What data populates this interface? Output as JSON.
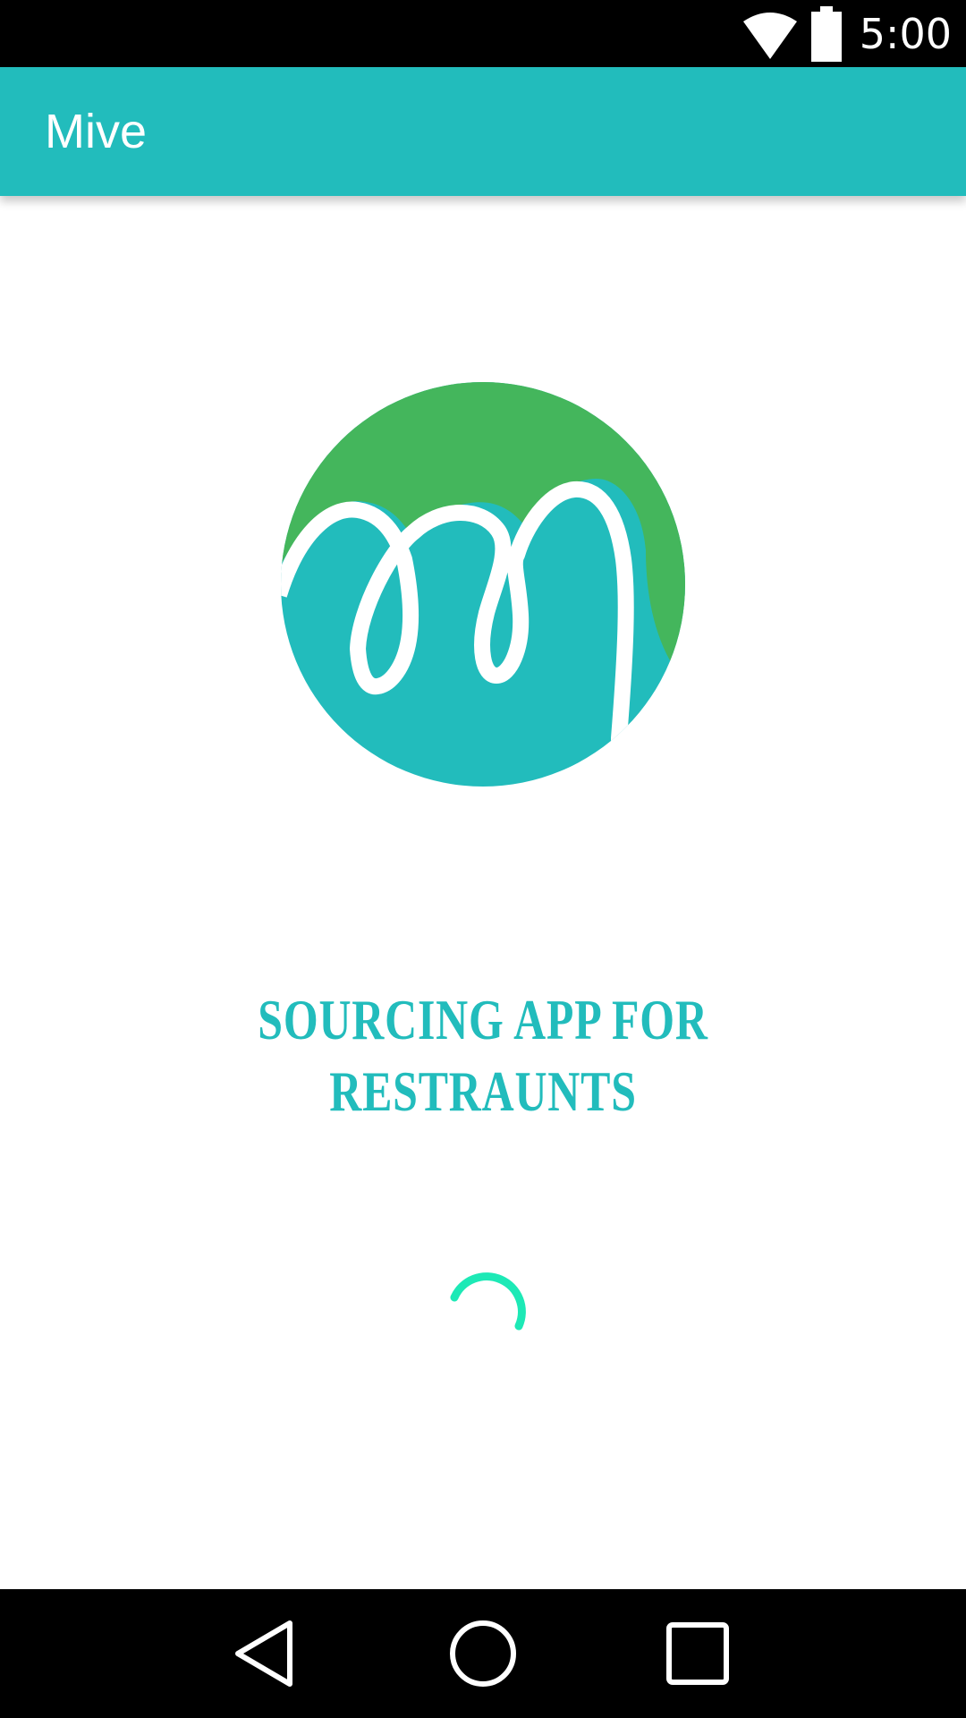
{
  "status_bar": {
    "time": "5:00",
    "icons": [
      "wifi-icon",
      "battery-icon"
    ]
  },
  "app_bar": {
    "title": "Mive"
  },
  "logo": {
    "name": "mive-logo",
    "colors": {
      "green": "#44b65c",
      "teal": "#22bcbc"
    }
  },
  "tagline": "SOURCING APP  FOR RESTRAUNTS",
  "loading": {
    "spinner_color": "#1de9b6"
  },
  "nav_bar": {
    "buttons": [
      "back-icon",
      "home-icon",
      "recents-icon"
    ]
  },
  "colors": {
    "primary": "#22bcbc",
    "status_bar": "#000000",
    "background": "#ffffff"
  }
}
